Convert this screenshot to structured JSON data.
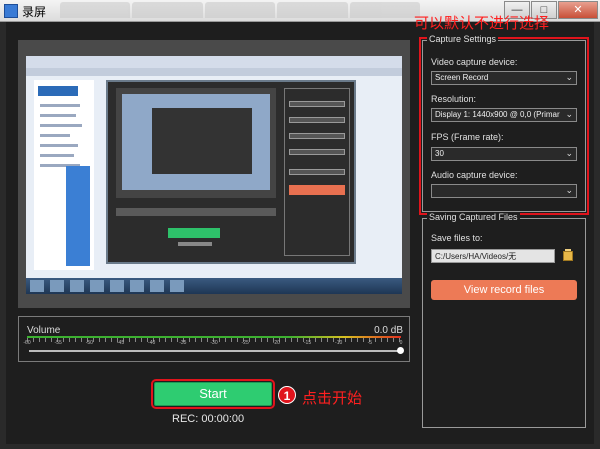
{
  "window": {
    "title": "录屏",
    "controls": [
      "—",
      "□",
      "✕"
    ]
  },
  "volume": {
    "label": "Volume",
    "value": "0.0 dB",
    "scale": [
      "-60",
      "-55",
      "-50",
      "-45",
      "-40",
      "-35",
      "-30",
      "-25",
      "-20",
      "-15",
      "-10",
      "-5",
      "0"
    ],
    "level": 1.0
  },
  "start_label": "Start",
  "rec_time": "REC: 00:00:00",
  "annotations": {
    "top": "可以默认不进行选择",
    "step_number": "1",
    "step_text": "点击开始",
    "color": "#ff2020"
  },
  "capture_settings": {
    "title": "Capture Settings",
    "video_device_label": "Video capture device:",
    "video_device_value": "Screen Record",
    "resolution_label": "Resolution:",
    "resolution_value": "Display 1: 1440x900 @ 0,0 (Primar",
    "fps_label": "FPS (Frame rate):",
    "fps_value": "30",
    "audio_device_label": "Audio capture device:",
    "audio_device_value": ""
  },
  "saving": {
    "title": "Saving Captured Files",
    "save_to_label": "Save files to:",
    "path_value": "C:/Users/HA/Videos/无",
    "view_label": "View record files"
  },
  "colors": {
    "start": "#2ecc71",
    "view": "#ed7a56",
    "highlight": "#e0141c",
    "background": "#1e1e1e"
  },
  "icons": [
    "app-icon",
    "folder-icon",
    "chevron-down-icon"
  ]
}
